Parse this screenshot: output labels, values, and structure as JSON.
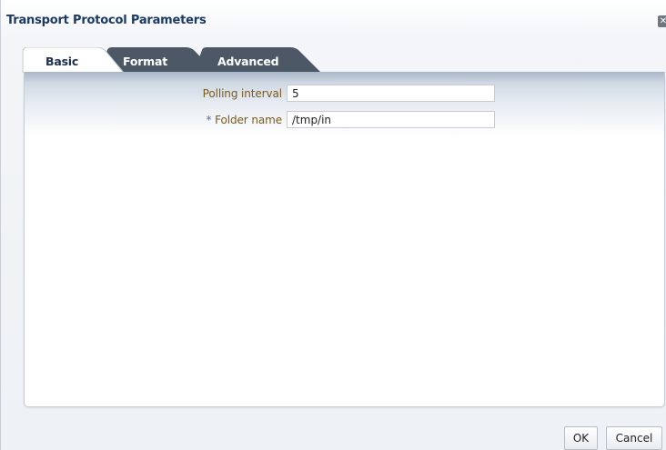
{
  "dialog": {
    "title": "Transport Protocol Parameters",
    "close_glyph": "✕"
  },
  "tabs": [
    {
      "label": "Basic",
      "active": true
    },
    {
      "label": "Format",
      "active": false
    },
    {
      "label": "Advanced",
      "active": false
    }
  ],
  "form": {
    "polling_interval": {
      "label": "Polling interval",
      "value": "5"
    },
    "folder_name": {
      "required_marker": "*",
      "label": "Folder name",
      "value": "/tmp/in"
    }
  },
  "footer": {
    "ok_label": "OK",
    "cancel_label": "Cancel"
  },
  "colors": {
    "title": "#1c3a63",
    "label": "#7a5a1e",
    "inactive_tab": "#4c5866",
    "required_marker": "#4a6ea5"
  }
}
